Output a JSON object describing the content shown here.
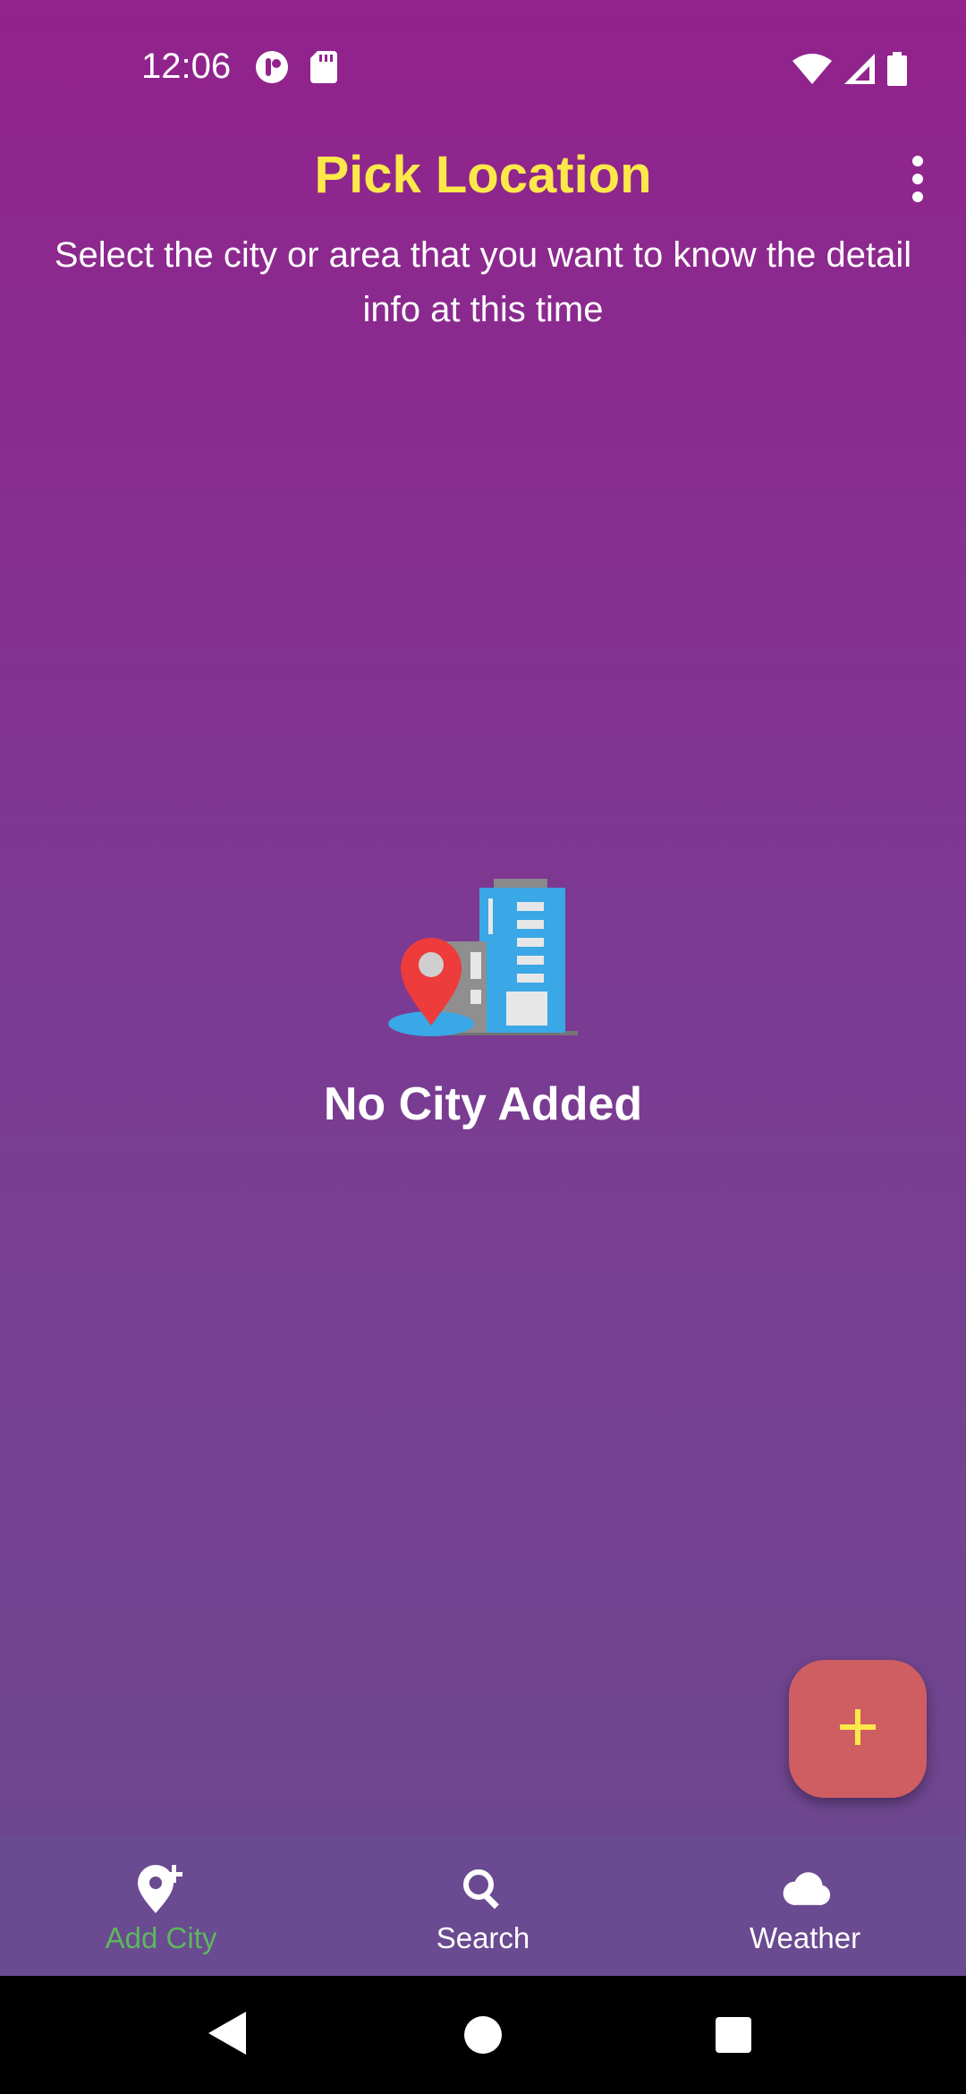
{
  "status_bar": {
    "time": "12:06",
    "left_icons": [
      "app-notification-icon",
      "sd-card-icon"
    ],
    "right_icons": [
      "wifi-icon",
      "cell-signal-icon",
      "battery-icon"
    ]
  },
  "header": {
    "title": "Pick Location",
    "subtitle": "Select the city or area that you want to know the detail info at this time",
    "menu_icon": "more-vert-icon"
  },
  "empty_state": {
    "icon": "city-location-illustration",
    "message": "No City Added"
  },
  "fab": {
    "icon": "plus-icon"
  },
  "bottom_nav": {
    "items": [
      {
        "label": "Add City",
        "icon": "add-location-icon",
        "active": true
      },
      {
        "label": "Search",
        "icon": "search-icon",
        "active": false
      },
      {
        "label": "Weather",
        "icon": "cloud-icon",
        "active": false
      }
    ]
  },
  "colors": {
    "title": "#fde84a",
    "background_top": "#92228c",
    "background_bottom": "#6a4a8e",
    "fab": "#cf5e63",
    "fab_icon": "#fde84a",
    "active_nav": "#5cb85c",
    "bottom_nav_bg": "#6a4a90"
  }
}
